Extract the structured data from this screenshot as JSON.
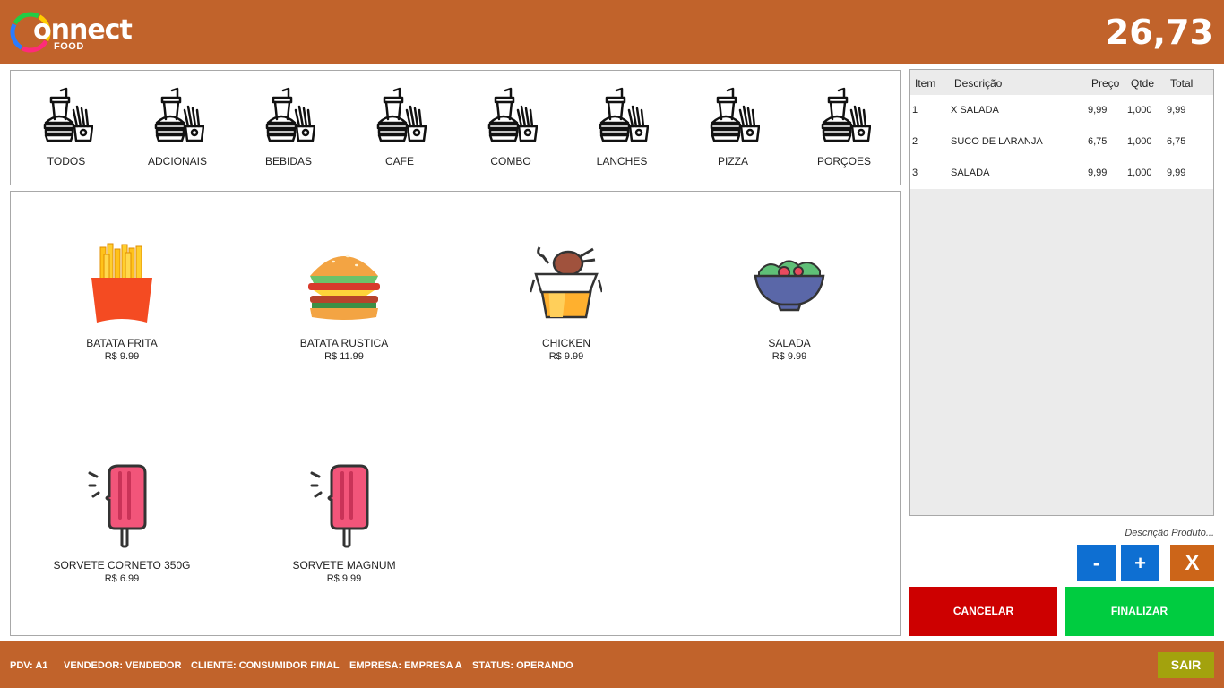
{
  "header": {
    "logo_text": "onnect",
    "logo_sub": "FOOD",
    "total": "26,73"
  },
  "categories": [
    {
      "label": "TODOS",
      "icon": "fast-food-icon"
    },
    {
      "label": "ADCIONAIS",
      "icon": "fast-food-icon"
    },
    {
      "label": "BEBIDAS",
      "icon": "fast-food-icon"
    },
    {
      "label": "CAFE",
      "icon": "fast-food-icon"
    },
    {
      "label": "COMBO",
      "icon": "fast-food-icon"
    },
    {
      "label": "LANCHES",
      "icon": "fast-food-icon"
    },
    {
      "label": "PIZZA",
      "icon": "fast-food-icon"
    },
    {
      "label": "PORÇOES",
      "icon": "fast-food-icon"
    }
  ],
  "products": [
    {
      "name": "BATATA FRITA",
      "price": "R$ 9.99",
      "icon": "fries-icon"
    },
    {
      "name": "BATATA RUSTICA",
      "price": "R$ 11.99",
      "icon": "burger-icon"
    },
    {
      "name": "CHICKEN",
      "price": "R$ 9.99",
      "icon": "chicken-box-icon"
    },
    {
      "name": "SALADA",
      "price": "R$ 9.99",
      "icon": "salad-bowl-icon"
    },
    {
      "name": "SORVETE CORNETO 350G",
      "price": "R$ 6.99",
      "icon": "popsicle-icon"
    },
    {
      "name": "SORVETE MAGNUM",
      "price": "R$ 9.99",
      "icon": "popsicle-icon"
    }
  ],
  "cart": {
    "headers": {
      "item": "Item",
      "desc": "Descrição",
      "price": "Preço",
      "qty": "Qtde",
      "total": "Total"
    },
    "rows": [
      {
        "item": "1",
        "desc": "X SALADA",
        "price": "9,99",
        "qty": "1,000",
        "total": "9,99"
      },
      {
        "item": "2",
        "desc": "SUCO DE LARANJA",
        "price": "6,75",
        "qty": "1,000",
        "total": "6,75"
      },
      {
        "item": "3",
        "desc": "SALADA",
        "price": "9,99",
        "qty": "1,000",
        "total": "9,99"
      }
    ]
  },
  "controls": {
    "desc_hint": "Descrição Produto...",
    "minus": "-",
    "plus": "+",
    "remove": "X",
    "cancel": "CANCELAR",
    "finish": "FINALIZAR"
  },
  "footer": {
    "pdv": "PDV: A1",
    "seller": "VENDEDOR: VENDEDOR",
    "client": "CLIENTE: CONSUMIDOR FINAL",
    "company": "EMPRESA: EMPRESA A",
    "status": "STATUS: OPERANDO",
    "exit": "SAIR"
  },
  "colors": {
    "brand": "#c1632b",
    "blue": "#0e6fd2",
    "orange": "#cc6519",
    "red": "#cd0000",
    "green": "#00cc40",
    "olive": "#a3a20d"
  }
}
